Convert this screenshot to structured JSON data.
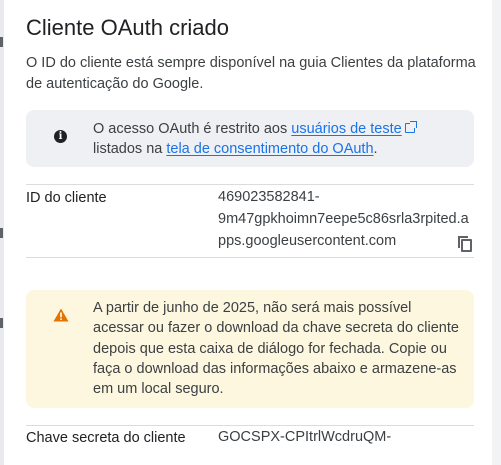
{
  "dialog": {
    "title": "Cliente OAuth criado",
    "description": "O ID do cliente está sempre disponível na guia Clientes da plataforma de autenticação do Google.",
    "info_banner": {
      "icon": "info-icon",
      "text_before": "O acesso OAuth é restrito aos ",
      "link_test_users": "usuários de teste",
      "text_middle": " listados na ",
      "link_consent_screen": "tela de consentimento do OAuth",
      "text_after": "."
    },
    "client_id": {
      "label": "ID do cliente",
      "value_line1": "469023582841-",
      "value_line2": "9m47gpkhoimn7eepe5c86srla3rpited.a",
      "value_line3": "pps.googleusercontent.com",
      "copy_icon": "copy-icon"
    },
    "warning_banner": {
      "icon": "warning-icon",
      "text": "A partir de junho de 2025, não será mais possível acessar ou fazer o download da chave secreta do cliente depois que esta caixa de diálogo for fechada. Copie ou faça o download das informações abaixo e armazene-as em um local seguro."
    },
    "client_secret": {
      "label": "Chave secreta do cliente",
      "value": "GOCSPX-CPItrlWcdruQM-"
    }
  },
  "colors": {
    "link": "#1a73e8",
    "info_bg": "#eef0f3",
    "warning_bg": "#fef7e0",
    "warning_icon": "#e37400"
  }
}
